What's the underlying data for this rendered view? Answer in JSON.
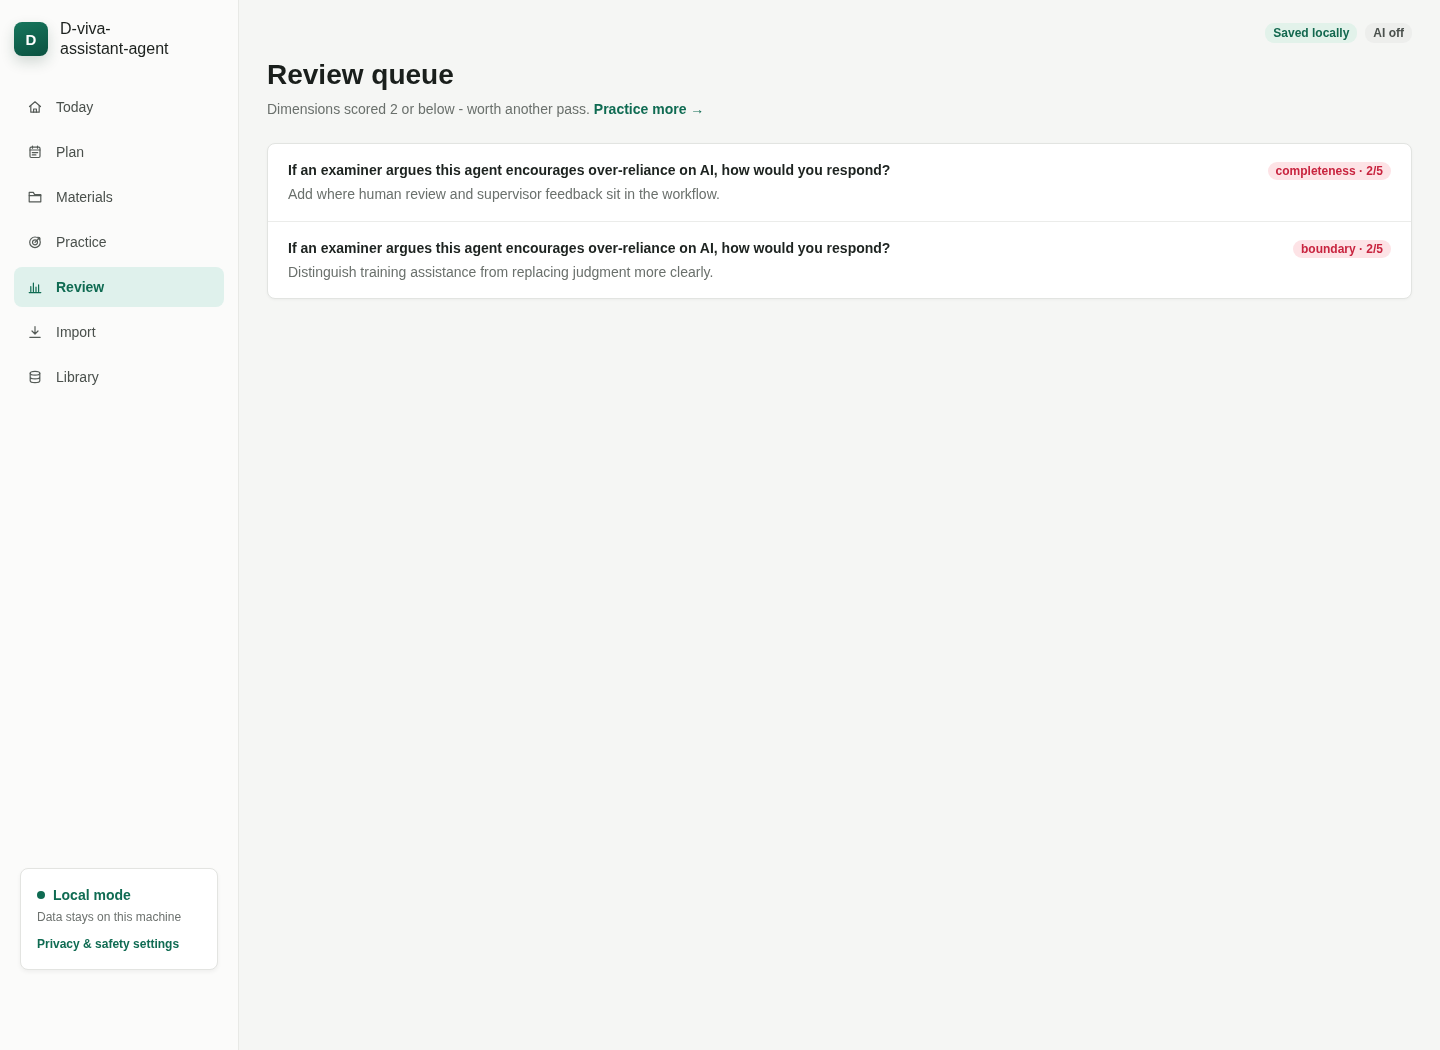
{
  "app": {
    "logo_letter": "D",
    "name": "D-viva-assistant-agent"
  },
  "nav": [
    {
      "label": "Today",
      "selected": false
    },
    {
      "label": "Plan",
      "selected": false
    },
    {
      "label": "Materials",
      "selected": false
    },
    {
      "label": "Practice",
      "selected": false
    },
    {
      "label": "Review",
      "selected": true
    },
    {
      "label": "Import",
      "selected": false
    },
    {
      "label": "Library",
      "selected": false
    }
  ],
  "mode_card": {
    "title": "Local mode",
    "color": "#0f6b52",
    "description": "Data stays on this machine",
    "link": "Privacy & safety settings"
  },
  "status_pills": [
    {
      "label": "Saved locally",
      "kind": "success"
    },
    {
      "label": "AI off",
      "kind": "neutral"
    }
  ],
  "page": {
    "title": "Review queue",
    "subtitle": "Dimensions scored 2 or below - worth another pass.",
    "subtitle_link": "Practice more →"
  },
  "queue": [
    {
      "question": "If an examiner argues this agent encourages over-reliance on AI, how would you respond?",
      "note": "Add where human review and supervisor feedback sit in the workflow.",
      "tag": "completeness · 2/5"
    },
    {
      "question": "If an examiner argues this agent encourages over-reliance on AI, how would you respond?",
      "note": "Distinguish training assistance from replacing judgment more clearly.",
      "tag": "boundary · 2/5"
    }
  ]
}
